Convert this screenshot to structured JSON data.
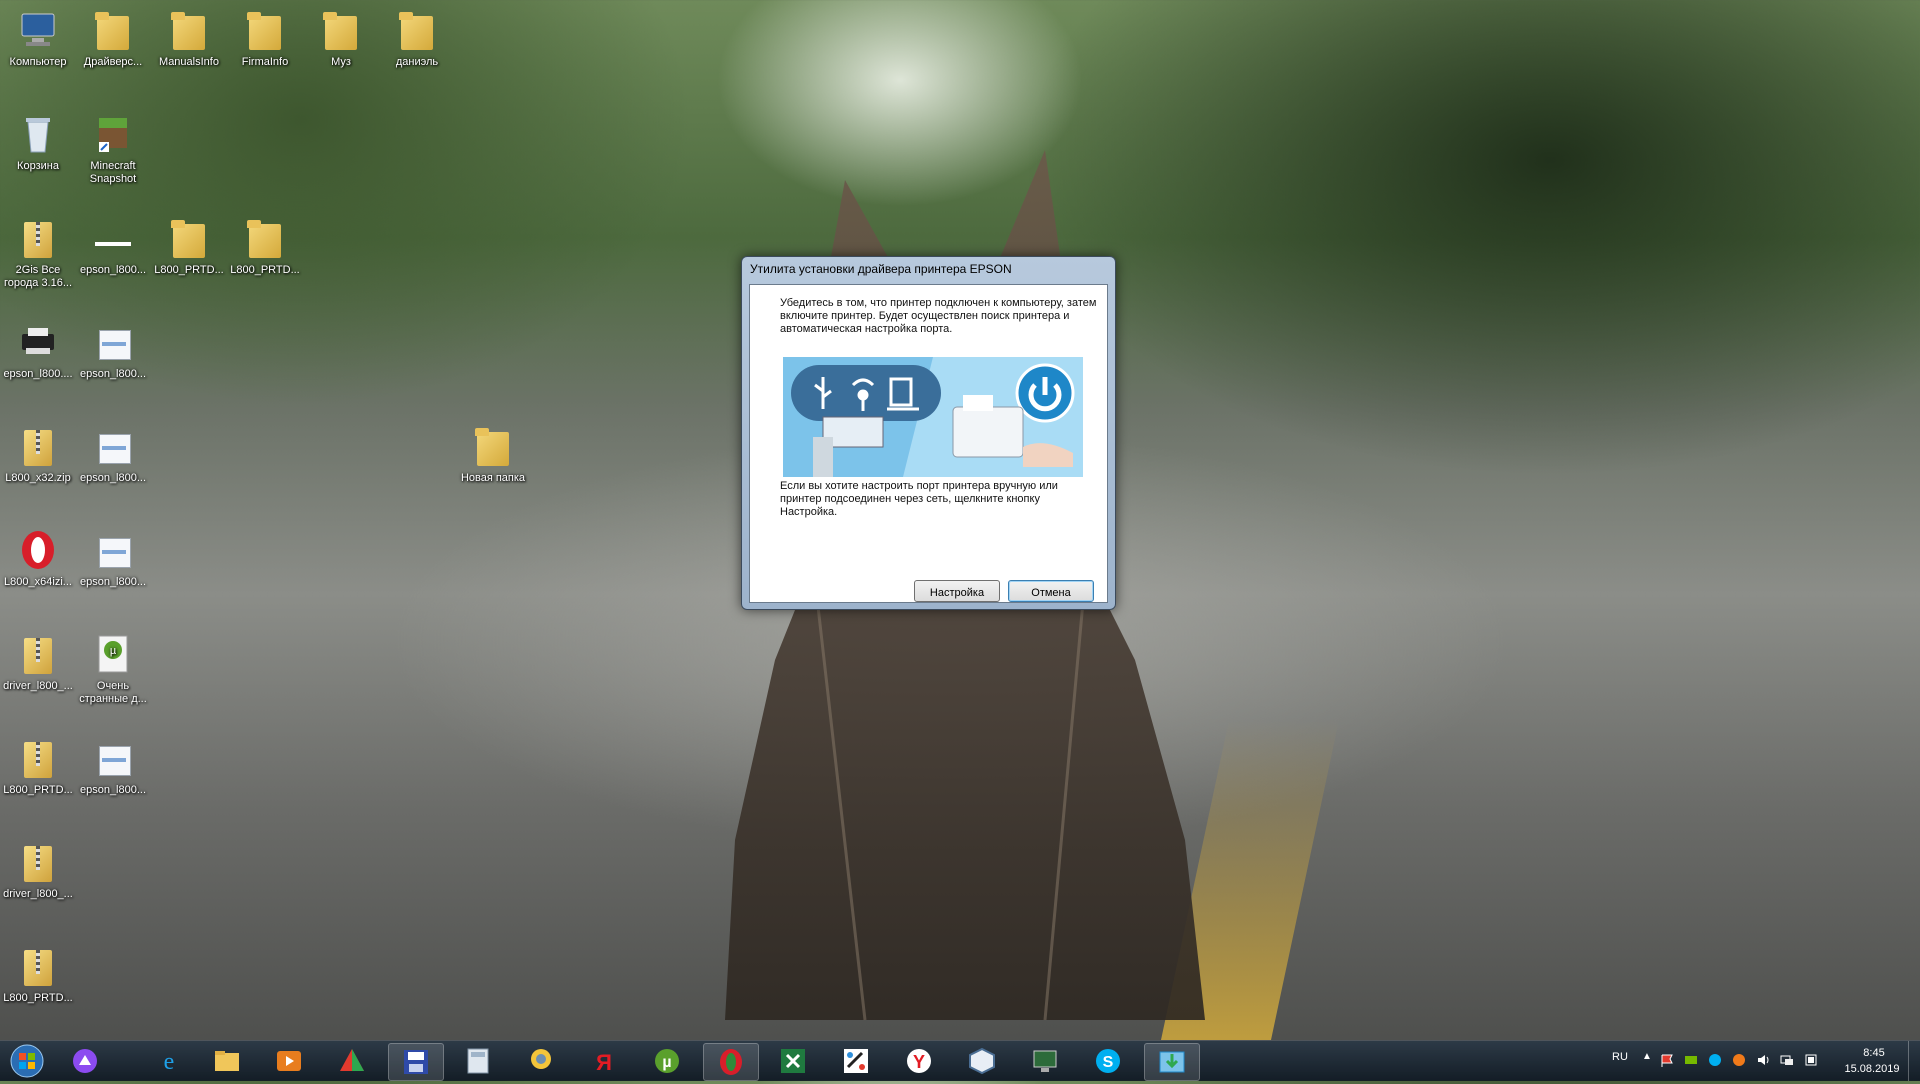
{
  "desktop": {
    "icons": [
      {
        "label": "Компьютер",
        "icon": "computer-icon"
      },
      {
        "label": "Драйверс...",
        "icon": "folder-icon"
      },
      {
        "label": "ManualsInfo",
        "icon": "folder-icon"
      },
      {
        "label": "FirmaInfo",
        "icon": "folder-icon"
      },
      {
        "label": "Муз",
        "icon": "folder-icon"
      },
      {
        "label": "даниэль",
        "icon": "folder-icon"
      },
      {
        "label": "Корзина",
        "icon": "recycle-bin-icon"
      },
      {
        "label": "Minecraft Snapshot",
        "icon": "minecraft-icon"
      },
      {
        "label": "2Gis Все города 3.16...",
        "icon": "zip-icon"
      },
      {
        "label": "epson_l800...",
        "icon": "document-icon"
      },
      {
        "label": "L800_PRTD...",
        "icon": "folder-icon"
      },
      {
        "label": "L800_PRTD...",
        "icon": "folder-icon"
      },
      {
        "label": "epson_l800....",
        "icon": "printer-icon"
      },
      {
        "label": "epson_l800...",
        "icon": "document-icon"
      },
      {
        "label": "L800_x32.zip",
        "icon": "zip-icon"
      },
      {
        "label": "epson_l800...",
        "icon": "document-icon"
      },
      {
        "label": "Новая папка",
        "icon": "folder-icon"
      },
      {
        "label": "L800_x64izi...",
        "icon": "opera-icon"
      },
      {
        "label": "epson_l800...",
        "icon": "document-icon"
      },
      {
        "label": "driver_l800_...",
        "icon": "zip-icon"
      },
      {
        "label": "Очень странные д...",
        "icon": "torrent-icon"
      },
      {
        "label": "L800_PRTD...",
        "icon": "zip-icon"
      },
      {
        "label": "epson_l800...",
        "icon": "document-icon"
      },
      {
        "label": "driver_l800_...",
        "icon": "zip-icon"
      },
      {
        "label": "L800_PRTD...",
        "icon": "zip-icon"
      }
    ]
  },
  "dialog": {
    "title": "Утилита установки драйвера принтера EPSON",
    "message": "Убедитесь в том, что принтер подключен к компьютеру, затем включите принтер. Будет осуществлен поиск принтера и автоматическая настройка порта.",
    "message2": "Если вы хотите настроить порт принтера вручную или принтер подсоединен через сеть, щелкните кнопку Настройка.",
    "settings_button": "Настройка",
    "cancel_button": "Отмена"
  },
  "taskbar": {
    "apps": [
      "ie-icon",
      "explorer-icon",
      "media-player-icon",
      "picasa-icon",
      "save-disk-icon",
      "calculator-icon",
      "chat-icon",
      "yandex-icon",
      "utorrent-icon",
      "opera-icon",
      "excel-icon",
      "paint-icon",
      "yandex-browser-icon",
      "cube-icon",
      "monitor-icon",
      "skype-icon",
      "installer-icon"
    ],
    "language": "RU",
    "time": "8:45",
    "date": "15.08.2019"
  },
  "colors": {
    "accent": "#1e87c8",
    "taskbar": "#1b2a38"
  }
}
